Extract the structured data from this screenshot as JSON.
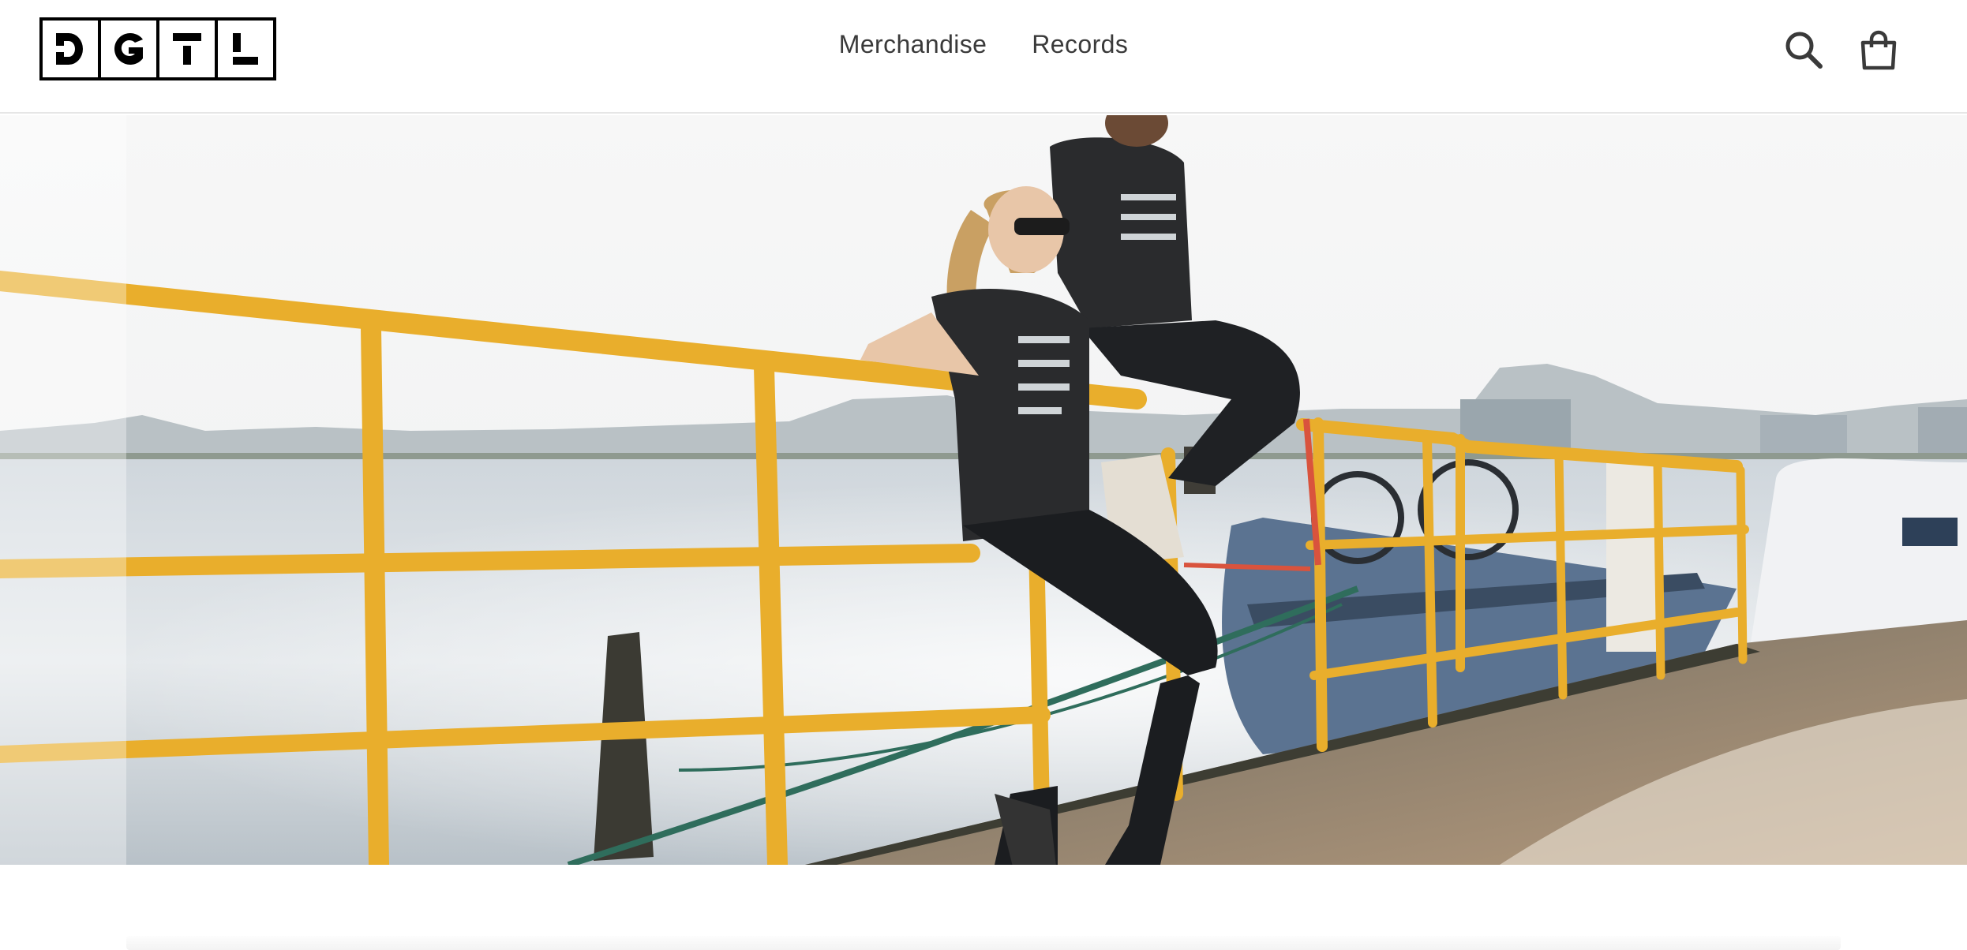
{
  "logo": {
    "letters": [
      "D",
      "G",
      "T",
      "L"
    ],
    "alt": "DGTL"
  },
  "nav": {
    "items": [
      {
        "label": "Merchandise"
      },
      {
        "label": "Records"
      }
    ]
  },
  "header_actions": {
    "search_icon": "search-icon",
    "cart_icon": "cart-icon"
  },
  "hero": {
    "description": "two people in black DGTL t-shirts sitting on a yellow harbour railing",
    "shirt_print": "DGTL",
    "colors": {
      "railing": "#e9ae2c",
      "sky": "#f4f4f3",
      "water": "#c4ccd3",
      "shirt": "#2a2b2d"
    }
  },
  "colors": {
    "text": "#3a3a3a",
    "border": "#e6e6e6",
    "logo": "#000000"
  }
}
